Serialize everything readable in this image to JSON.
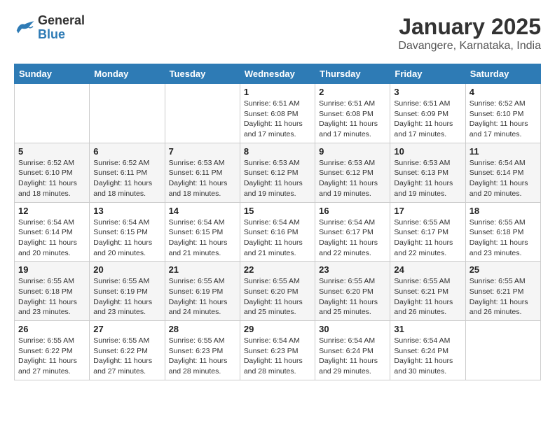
{
  "logo": {
    "text_general": "General",
    "text_blue": "Blue"
  },
  "header": {
    "month": "January 2025",
    "location": "Davangere, Karnataka, India"
  },
  "weekdays": [
    "Sunday",
    "Monday",
    "Tuesday",
    "Wednesday",
    "Thursday",
    "Friday",
    "Saturday"
  ],
  "weeks": [
    [
      {
        "day": "",
        "content": ""
      },
      {
        "day": "",
        "content": ""
      },
      {
        "day": "",
        "content": ""
      },
      {
        "day": "1",
        "content": "Sunrise: 6:51 AM\nSunset: 6:08 PM\nDaylight: 11 hours and 17 minutes."
      },
      {
        "day": "2",
        "content": "Sunrise: 6:51 AM\nSunset: 6:08 PM\nDaylight: 11 hours and 17 minutes."
      },
      {
        "day": "3",
        "content": "Sunrise: 6:51 AM\nSunset: 6:09 PM\nDaylight: 11 hours and 17 minutes."
      },
      {
        "day": "4",
        "content": "Sunrise: 6:52 AM\nSunset: 6:10 PM\nDaylight: 11 hours and 17 minutes."
      }
    ],
    [
      {
        "day": "5",
        "content": "Sunrise: 6:52 AM\nSunset: 6:10 PM\nDaylight: 11 hours and 18 minutes."
      },
      {
        "day": "6",
        "content": "Sunrise: 6:52 AM\nSunset: 6:11 PM\nDaylight: 11 hours and 18 minutes."
      },
      {
        "day": "7",
        "content": "Sunrise: 6:53 AM\nSunset: 6:11 PM\nDaylight: 11 hours and 18 minutes."
      },
      {
        "day": "8",
        "content": "Sunrise: 6:53 AM\nSunset: 6:12 PM\nDaylight: 11 hours and 19 minutes."
      },
      {
        "day": "9",
        "content": "Sunrise: 6:53 AM\nSunset: 6:12 PM\nDaylight: 11 hours and 19 minutes."
      },
      {
        "day": "10",
        "content": "Sunrise: 6:53 AM\nSunset: 6:13 PM\nDaylight: 11 hours and 19 minutes."
      },
      {
        "day": "11",
        "content": "Sunrise: 6:54 AM\nSunset: 6:14 PM\nDaylight: 11 hours and 20 minutes."
      }
    ],
    [
      {
        "day": "12",
        "content": "Sunrise: 6:54 AM\nSunset: 6:14 PM\nDaylight: 11 hours and 20 minutes."
      },
      {
        "day": "13",
        "content": "Sunrise: 6:54 AM\nSunset: 6:15 PM\nDaylight: 11 hours and 20 minutes."
      },
      {
        "day": "14",
        "content": "Sunrise: 6:54 AM\nSunset: 6:15 PM\nDaylight: 11 hours and 21 minutes."
      },
      {
        "day": "15",
        "content": "Sunrise: 6:54 AM\nSunset: 6:16 PM\nDaylight: 11 hours and 21 minutes."
      },
      {
        "day": "16",
        "content": "Sunrise: 6:54 AM\nSunset: 6:17 PM\nDaylight: 11 hours and 22 minutes."
      },
      {
        "day": "17",
        "content": "Sunrise: 6:55 AM\nSunset: 6:17 PM\nDaylight: 11 hours and 22 minutes."
      },
      {
        "day": "18",
        "content": "Sunrise: 6:55 AM\nSunset: 6:18 PM\nDaylight: 11 hours and 23 minutes."
      }
    ],
    [
      {
        "day": "19",
        "content": "Sunrise: 6:55 AM\nSunset: 6:18 PM\nDaylight: 11 hours and 23 minutes."
      },
      {
        "day": "20",
        "content": "Sunrise: 6:55 AM\nSunset: 6:19 PM\nDaylight: 11 hours and 23 minutes."
      },
      {
        "day": "21",
        "content": "Sunrise: 6:55 AM\nSunset: 6:19 PM\nDaylight: 11 hours and 24 minutes."
      },
      {
        "day": "22",
        "content": "Sunrise: 6:55 AM\nSunset: 6:20 PM\nDaylight: 11 hours and 25 minutes."
      },
      {
        "day": "23",
        "content": "Sunrise: 6:55 AM\nSunset: 6:20 PM\nDaylight: 11 hours and 25 minutes."
      },
      {
        "day": "24",
        "content": "Sunrise: 6:55 AM\nSunset: 6:21 PM\nDaylight: 11 hours and 26 minutes."
      },
      {
        "day": "25",
        "content": "Sunrise: 6:55 AM\nSunset: 6:21 PM\nDaylight: 11 hours and 26 minutes."
      }
    ],
    [
      {
        "day": "26",
        "content": "Sunrise: 6:55 AM\nSunset: 6:22 PM\nDaylight: 11 hours and 27 minutes."
      },
      {
        "day": "27",
        "content": "Sunrise: 6:55 AM\nSunset: 6:22 PM\nDaylight: 11 hours and 27 minutes."
      },
      {
        "day": "28",
        "content": "Sunrise: 6:55 AM\nSunset: 6:23 PM\nDaylight: 11 hours and 28 minutes."
      },
      {
        "day": "29",
        "content": "Sunrise: 6:54 AM\nSunset: 6:23 PM\nDaylight: 11 hours and 28 minutes."
      },
      {
        "day": "30",
        "content": "Sunrise: 6:54 AM\nSunset: 6:24 PM\nDaylight: 11 hours and 29 minutes."
      },
      {
        "day": "31",
        "content": "Sunrise: 6:54 AM\nSunset: 6:24 PM\nDaylight: 11 hours and 30 minutes."
      },
      {
        "day": "",
        "content": ""
      }
    ]
  ]
}
